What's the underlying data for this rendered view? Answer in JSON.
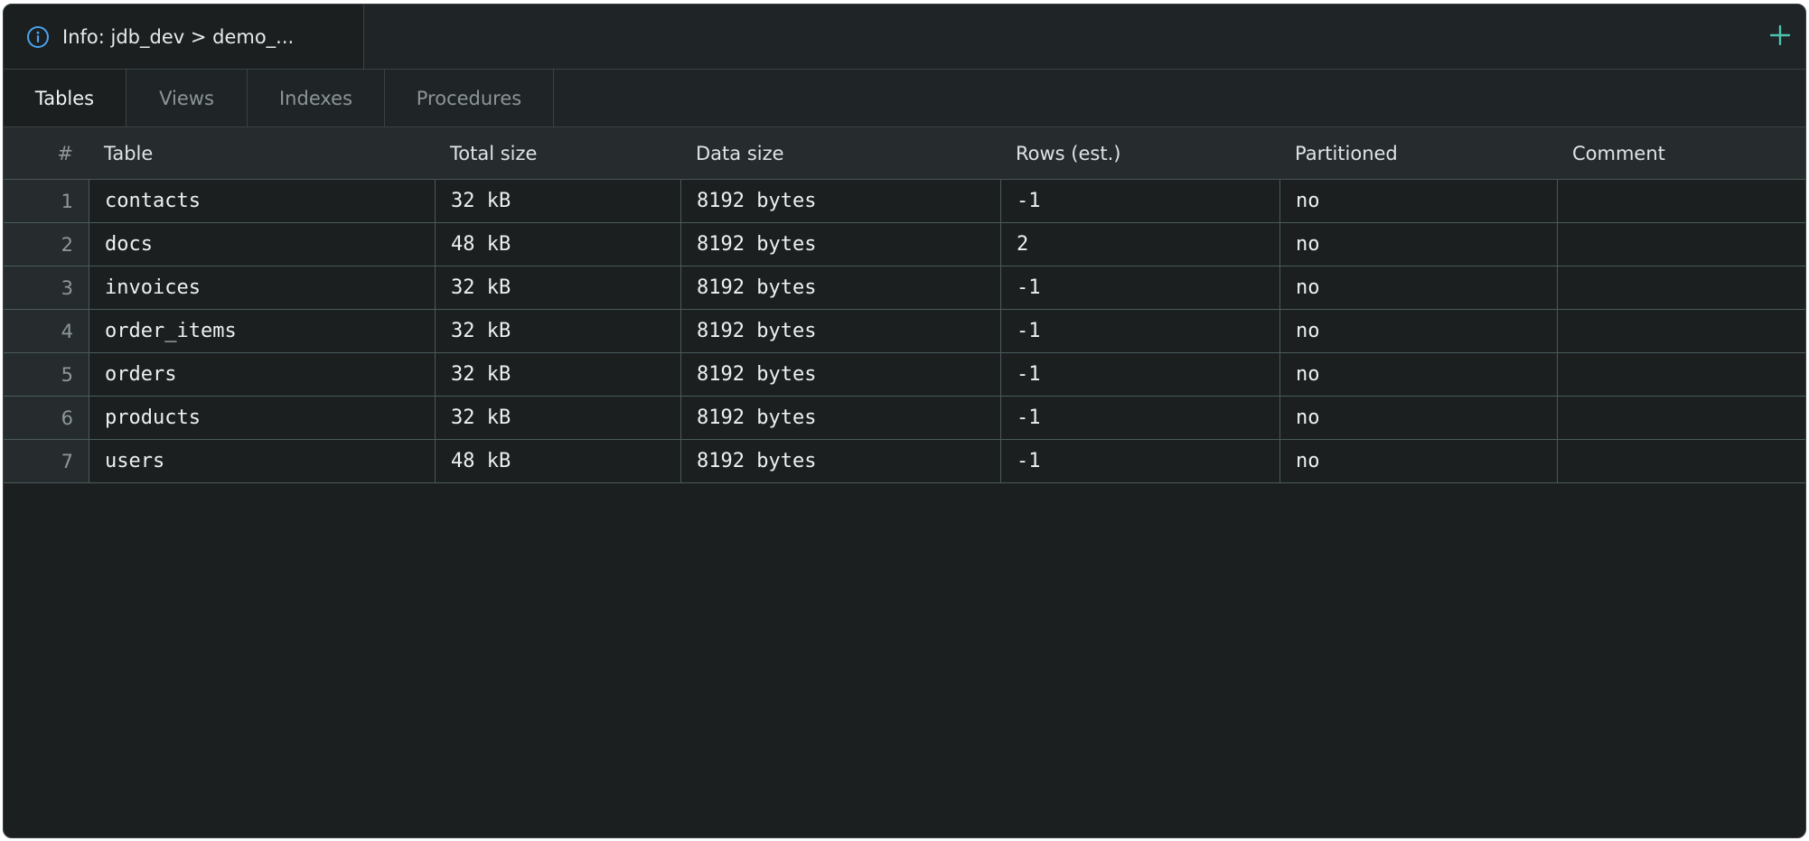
{
  "document_tab": {
    "title": "Info: jdb_dev > demo_...",
    "icon": "info-icon"
  },
  "add_button": {
    "icon": "plus-icon"
  },
  "section_tabs": [
    {
      "label": "Tables",
      "active": true
    },
    {
      "label": "Views",
      "active": false
    },
    {
      "label": "Indexes",
      "active": false
    },
    {
      "label": "Procedures",
      "active": false
    }
  ],
  "table": {
    "columns": [
      "#",
      "Table",
      "Total size",
      "Data size",
      "Rows (est.)",
      "Partitioned",
      "Comment"
    ],
    "rows": [
      {
        "num": "1",
        "table": "contacts",
        "total_size": "32 kB",
        "data_size": "8192 bytes",
        "rows_est": "-1",
        "partitioned": "no",
        "comment": ""
      },
      {
        "num": "2",
        "table": "docs",
        "total_size": "48 kB",
        "data_size": "8192 bytes",
        "rows_est": "2",
        "partitioned": "no",
        "comment": ""
      },
      {
        "num": "3",
        "table": "invoices",
        "total_size": "32 kB",
        "data_size": "8192 bytes",
        "rows_est": "-1",
        "partitioned": "no",
        "comment": ""
      },
      {
        "num": "4",
        "table": "order_items",
        "total_size": "32 kB",
        "data_size": "8192 bytes",
        "rows_est": "-1",
        "partitioned": "no",
        "comment": ""
      },
      {
        "num": "5",
        "table": "orders",
        "total_size": "32 kB",
        "data_size": "8192 bytes",
        "rows_est": "-1",
        "partitioned": "no",
        "comment": ""
      },
      {
        "num": "6",
        "table": "products",
        "total_size": "32 kB",
        "data_size": "8192 bytes",
        "rows_est": "-1",
        "partitioned": "no",
        "comment": ""
      },
      {
        "num": "7",
        "table": "users",
        "total_size": "48 kB",
        "data_size": "8192 bytes",
        "rows_est": "-1",
        "partitioned": "no",
        "comment": ""
      }
    ]
  },
  "colors": {
    "background": "#1b1f20",
    "accent_info": "#4aa3f0",
    "accent_add": "#4fc2b0",
    "grid_line": "#4a5a5a"
  }
}
